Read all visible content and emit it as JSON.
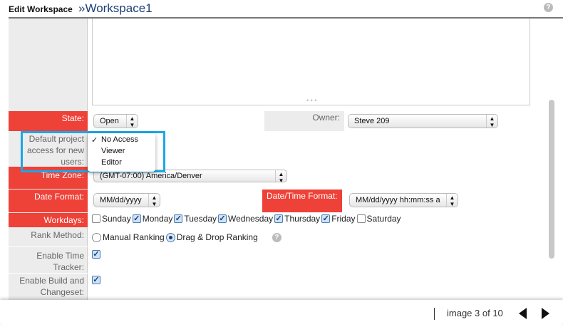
{
  "header": {
    "title": "Edit Workspace",
    "workspace": "»Workspace1"
  },
  "form": {
    "state": {
      "label": "State:",
      "value": "Open"
    },
    "owner": {
      "label": "Owner:",
      "value": "Steve 209"
    },
    "default_access": {
      "label": "Default project access for new users:",
      "options": [
        "No Access",
        "Viewer",
        "Editor"
      ],
      "selected": "No Access"
    },
    "time_zone": {
      "label": "Time Zone:",
      "value": "(GMT-07:00) America/Denver"
    },
    "date_format": {
      "label": "Date Format:",
      "value": "MM/dd/yyyy"
    },
    "datetime_format": {
      "label": "Date/Time Format:",
      "value": "MM/dd/yyyy hh:mm:ss a"
    },
    "workdays": {
      "label": "Workdays:",
      "days": [
        {
          "name": "Sunday",
          "checked": false
        },
        {
          "name": "Monday",
          "checked": true
        },
        {
          "name": "Tuesday",
          "checked": true
        },
        {
          "name": "Wednesday",
          "checked": true
        },
        {
          "name": "Thursday",
          "checked": true
        },
        {
          "name": "Friday",
          "checked": true
        },
        {
          "name": "Saturday",
          "checked": false
        }
      ]
    },
    "rank_method": {
      "label": "Rank Method:",
      "options": [
        "Manual Ranking",
        "Drag & Drop Ranking"
      ],
      "selected": "Drag & Drop Ranking"
    },
    "time_tracker": {
      "label": "Enable Time Tracker:",
      "checked": true
    },
    "build_changeset": {
      "label": "Enable Build and Changeset:",
      "checked": true
    }
  },
  "footer": {
    "pagination": "image 3 of 10"
  },
  "colors": {
    "required": "#ee4138",
    "highlight": "#1aa7e8"
  }
}
